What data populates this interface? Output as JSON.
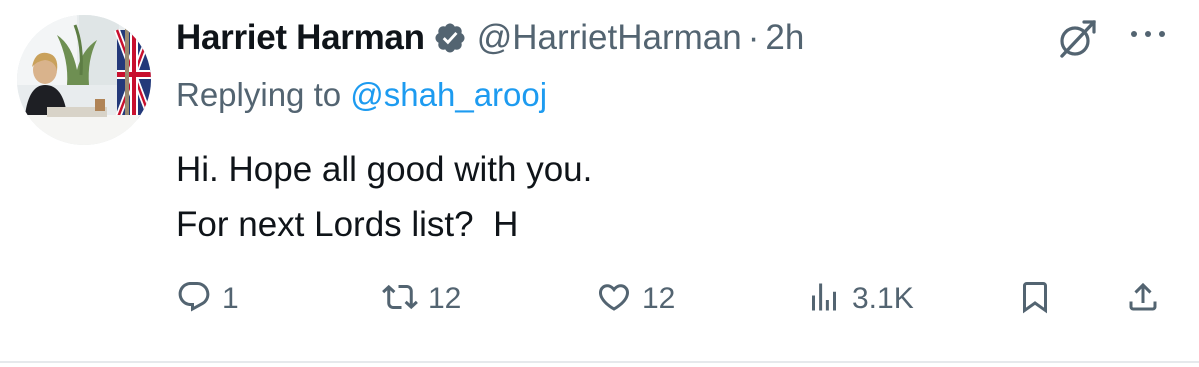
{
  "tweet": {
    "author": {
      "display_name": "Harriet Harman",
      "handle": "@HarrietHarman",
      "verified": true
    },
    "separator": "·",
    "time": "2h",
    "reply_prefix": "Replying to",
    "reply_to": "@shah_arooj",
    "body_lines": [
      "Hi. Hope all good with you.",
      "For next Lords list?  H"
    ],
    "actions": {
      "replies": "1",
      "reposts": "12",
      "likes": "12",
      "views": "3.1K"
    }
  },
  "icons": {
    "verified": "verified-badge-icon",
    "grok": "grok-icon",
    "more": "more-dots-icon",
    "reply": "reply-icon",
    "repost": "repost-icon",
    "like": "heart-icon",
    "views": "views-icon",
    "bookmark": "bookmark-icon",
    "share": "share-icon"
  },
  "colors": {
    "text": "#0f1419",
    "secondary": "#536471",
    "link": "#1d9bf0",
    "verified_badge": "#536471"
  }
}
